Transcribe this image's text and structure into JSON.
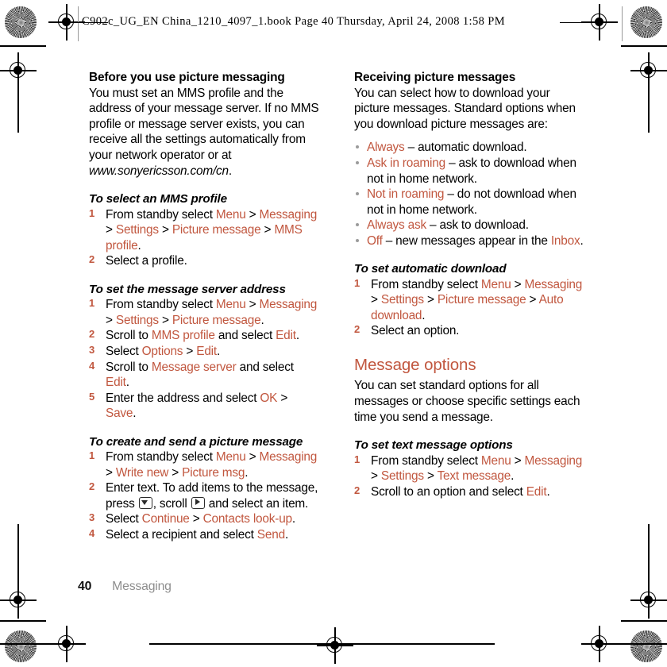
{
  "header": {
    "text": "C902c_UG_EN China_1210_4097_1.book  Page 40  Thursday, April 24, 2008  1:58 PM"
  },
  "footer": {
    "page_number": "40",
    "chapter": "Messaging"
  },
  "colors": {
    "accent": "#C1573F",
    "body_text": "#000000",
    "footer_chapter": "#8E8E8E",
    "bullet": "#9B9B9B"
  },
  "left_column": {
    "heading": "Before you use picture messaging",
    "intro_parts": [
      {
        "text": "You must set an MMS profile and the address of your message server. If no MMS profile or message server exists, you can receive all the settings automatically from your network operator or at ",
        "style": "plain"
      },
      {
        "text": "www.sonyericsson.com/cn",
        "style": "italic"
      },
      {
        "text": ".",
        "style": "plain"
      }
    ],
    "procedures": [
      {
        "title": "To select an MMS profile",
        "steps": [
          {
            "number": "1",
            "parts": [
              {
                "text": "From standby select ",
                "style": "plain"
              },
              {
                "text": "Menu",
                "style": "ui"
              },
              {
                "text": " > ",
                "style": "plain"
              },
              {
                "text": "Messaging",
                "style": "ui"
              },
              {
                "text": " > ",
                "style": "plain"
              },
              {
                "text": "Settings",
                "style": "ui"
              },
              {
                "text": " > ",
                "style": "plain"
              },
              {
                "text": "Picture message",
                "style": "ui"
              },
              {
                "text": " > ",
                "style": "plain"
              },
              {
                "text": "MMS profile",
                "style": "ui"
              },
              {
                "text": ".",
                "style": "plain"
              }
            ]
          },
          {
            "number": "2",
            "parts": [
              {
                "text": "Select a profile.",
                "style": "plain"
              }
            ]
          }
        ]
      },
      {
        "title": "To set the message server address",
        "steps": [
          {
            "number": "1",
            "parts": [
              {
                "text": "From standby select ",
                "style": "plain"
              },
              {
                "text": "Menu",
                "style": "ui"
              },
              {
                "text": " > ",
                "style": "plain"
              },
              {
                "text": "Messaging",
                "style": "ui"
              },
              {
                "text": " > ",
                "style": "plain"
              },
              {
                "text": "Settings",
                "style": "ui"
              },
              {
                "text": " > ",
                "style": "plain"
              },
              {
                "text": "Picture message",
                "style": "ui"
              },
              {
                "text": ".",
                "style": "plain"
              }
            ]
          },
          {
            "number": "2",
            "parts": [
              {
                "text": "Scroll to ",
                "style": "plain"
              },
              {
                "text": "MMS profile",
                "style": "ui"
              },
              {
                "text": " and select ",
                "style": "plain"
              },
              {
                "text": "Edit",
                "style": "ui"
              },
              {
                "text": ".",
                "style": "plain"
              }
            ]
          },
          {
            "number": "3",
            "parts": [
              {
                "text": "Select ",
                "style": "plain"
              },
              {
                "text": "Options",
                "style": "ui"
              },
              {
                "text": " > ",
                "style": "plain"
              },
              {
                "text": "Edit",
                "style": "ui"
              },
              {
                "text": ".",
                "style": "plain"
              }
            ]
          },
          {
            "number": "4",
            "parts": [
              {
                "text": "Scroll to ",
                "style": "plain"
              },
              {
                "text": "Message server",
                "style": "ui"
              },
              {
                "text": " and select ",
                "style": "plain"
              },
              {
                "text": "Edit",
                "style": "ui"
              },
              {
                "text": ".",
                "style": "plain"
              }
            ]
          },
          {
            "number": "5",
            "parts": [
              {
                "text": "Enter the address and select ",
                "style": "plain"
              },
              {
                "text": "OK",
                "style": "ui"
              },
              {
                "text": " > ",
                "style": "plain"
              },
              {
                "text": "Save",
                "style": "ui"
              },
              {
                "text": ".",
                "style": "plain"
              }
            ]
          }
        ]
      },
      {
        "title": "To create and send a picture message",
        "steps": [
          {
            "number": "1",
            "parts": [
              {
                "text": "From standby select ",
                "style": "plain"
              },
              {
                "text": "Menu",
                "style": "ui"
              },
              {
                "text": " > ",
                "style": "plain"
              },
              {
                "text": "Messaging",
                "style": "ui"
              },
              {
                "text": " > ",
                "style": "plain"
              },
              {
                "text": "Write new",
                "style": "ui"
              },
              {
                "text": " > ",
                "style": "plain"
              },
              {
                "text": "Picture msg",
                "style": "ui"
              },
              {
                "text": ".",
                "style": "plain"
              }
            ]
          },
          {
            "number": "2",
            "parts": [
              {
                "text": "Enter text. To add items to the message, press ",
                "style": "plain"
              },
              {
                "text": "",
                "style": "icon-navkey-down"
              },
              {
                "text": ", scroll ",
                "style": "plain"
              },
              {
                "text": "",
                "style": "icon-navkey-right"
              },
              {
                "text": " and select an item.",
                "style": "plain"
              }
            ]
          },
          {
            "number": "3",
            "parts": [
              {
                "text": "Select ",
                "style": "plain"
              },
              {
                "text": "Continue",
                "style": "ui"
              },
              {
                "text": " > ",
                "style": "plain"
              },
              {
                "text": "Contacts look-up",
                "style": "ui"
              },
              {
                "text": ".",
                "style": "plain"
              }
            ]
          },
          {
            "number": "4",
            "parts": [
              {
                "text": "Select a recipient and select ",
                "style": "plain"
              },
              {
                "text": "Send",
                "style": "ui"
              },
              {
                "text": ".",
                "style": "plain"
              }
            ]
          }
        ]
      }
    ]
  },
  "right_column": {
    "heading": "Receiving picture messages",
    "intro": "You can select how to download your picture messages. Standard options when you download picture messages are:",
    "options": [
      {
        "parts": [
          {
            "text": "Always",
            "style": "ui"
          },
          {
            "text": " – automatic download.",
            "style": "plain"
          }
        ]
      },
      {
        "parts": [
          {
            "text": "Ask in roaming",
            "style": "ui"
          },
          {
            "text": " – ask to download when not in home network.",
            "style": "plain"
          }
        ]
      },
      {
        "parts": [
          {
            "text": "Not in roaming",
            "style": "ui"
          },
          {
            "text": " – do not download when not in home network.",
            "style": "plain"
          }
        ]
      },
      {
        "parts": [
          {
            "text": "Always ask",
            "style": "ui"
          },
          {
            "text": " – ask to download.",
            "style": "plain"
          }
        ]
      },
      {
        "parts": [
          {
            "text": "Off",
            "style": "ui"
          },
          {
            "text": " – new messages appear in the ",
            "style": "plain"
          },
          {
            "text": "Inbox",
            "style": "ui"
          },
          {
            "text": ".",
            "style": "plain"
          }
        ]
      }
    ],
    "auto_download_procedure": {
      "title": "To set automatic download",
      "steps": [
        {
          "number": "1",
          "parts": [
            {
              "text": "From standby select ",
              "style": "plain"
            },
            {
              "text": "Menu",
              "style": "ui"
            },
            {
              "text": " > ",
              "style": "plain"
            },
            {
              "text": "Messaging",
              "style": "ui"
            },
            {
              "text": " > ",
              "style": "plain"
            },
            {
              "text": "Settings",
              "style": "ui"
            },
            {
              "text": " > ",
              "style": "plain"
            },
            {
              "text": "Picture message",
              "style": "ui"
            },
            {
              "text": " > ",
              "style": "plain"
            },
            {
              "text": "Auto download",
              "style": "ui"
            },
            {
              "text": ".",
              "style": "plain"
            }
          ]
        },
        {
          "number": "2",
          "parts": [
            {
              "text": "Select an option.",
              "style": "plain"
            }
          ]
        }
      ]
    },
    "message_options_section": {
      "title": "Message options",
      "intro": "You can set standard options for all messages or choose specific settings each time you send a message.",
      "procedure": {
        "title": "To set text message options",
        "steps": [
          {
            "number": "1",
            "parts": [
              {
                "text": "From standby select ",
                "style": "plain"
              },
              {
                "text": "Menu",
                "style": "ui"
              },
              {
                "text": " > ",
                "style": "plain"
              },
              {
                "text": "Messaging",
                "style": "ui"
              },
              {
                "text": " > ",
                "style": "plain"
              },
              {
                "text": "Settings",
                "style": "ui"
              },
              {
                "text": " > ",
                "style": "plain"
              },
              {
                "text": "Text message",
                "style": "ui"
              },
              {
                "text": ".",
                "style": "plain"
              }
            ]
          },
          {
            "number": "2",
            "parts": [
              {
                "text": "Scroll to an option and select ",
                "style": "plain"
              },
              {
                "text": "Edit",
                "style": "ui"
              },
              {
                "text": ".",
                "style": "plain"
              }
            ]
          }
        ]
      }
    }
  }
}
